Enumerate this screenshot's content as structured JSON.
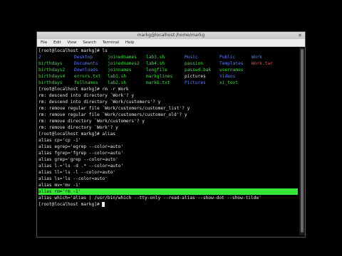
{
  "window": {
    "title": "markg@localhost:/home/markg",
    "close_glyph": "✕"
  },
  "menu": [
    "File",
    "Edit",
    "View",
    "Search",
    "Terminal",
    "Help"
  ],
  "colors": {
    "directory": "#5b7cff",
    "executable": "#3fdf3f",
    "archive": "#e34b4b",
    "image": "#d94bd9",
    "highlight_bg": "#36e636"
  },
  "ls_prompt": "[root@localhost markg]# ls",
  "ls_rows": [
    [
      {
        "t": "2",
        "c": "c-blue"
      },
      {
        "t": "Desktop",
        "c": "c-blue"
      },
      {
        "t": "joinednames",
        "c": "c-green"
      },
      {
        "t": "lab3.sh",
        "c": "c-green"
      },
      {
        "t": "Music",
        "c": "c-blue"
      },
      {
        "t": "Public",
        "c": "c-blue"
      },
      {
        "t": "Work",
        "c": "c-blue"
      }
    ],
    [
      {
        "t": "birthdays",
        "c": "c-green"
      },
      {
        "t": "Documents",
        "c": "c-blue"
      },
      {
        "t": "joinednames2",
        "c": "c-green"
      },
      {
        "t": "lab4.sh",
        "c": "c-green"
      },
      {
        "t": "passion",
        "c": "c-green"
      },
      {
        "t": "Templates",
        "c": "c-blue"
      },
      {
        "t": "Work.tar",
        "c": "c-red"
      }
    ],
    [
      {
        "t": "birthdays2",
        "c": "c-green"
      },
      {
        "t": "Downloads",
        "c": "c-blue"
      },
      {
        "t": "joinnames",
        "c": "c-green"
      },
      {
        "t": "longfile",
        "c": "c-green"
      },
      {
        "t": "passwd.bak",
        "c": "c-green"
      },
      {
        "t": "usernames",
        "c": "c-green"
      },
      {
        "t": "",
        "c": "c-white"
      }
    ],
    [
      {
        "t": "birthdays4",
        "c": "c-green"
      },
      {
        "t": "errors.txt",
        "c": "c-green"
      },
      {
        "t": "lab1.sh",
        "c": "c-green"
      },
      {
        "t": "markglines",
        "c": "c-green"
      },
      {
        "t": "pictures",
        "c": "c-white"
      },
      {
        "t": "Videos",
        "c": "c-blue"
      },
      {
        "t": "",
        "c": "c-white"
      }
    ],
    [
      {
        "t": "birthdays",
        "c": "c-green"
      },
      {
        "t": "fullnames",
        "c": "c-green"
      },
      {
        "t": "lab2.sh",
        "c": "c-green"
      },
      {
        "t": "markG.txt",
        "c": "c-green"
      },
      {
        "t": "Pictures",
        "c": "c-blue"
      },
      {
        "t": "xi_text",
        "c": "c-green"
      },
      {
        "t": "",
        "c": "c-white"
      }
    ]
  ],
  "lines": [
    "[root@localhost markg]# rm -r Work",
    "rm: descend into directory `Work'? y",
    "rm: descend into directory `Work/customers'? y",
    "rm: remove regular file `Work/customers/customer_list'? y",
    "rm: remove regular file `Work/customers/customer_old'? y",
    "rm: remove directory `Work/customers'? y",
    "rm: remove directory `Work'? y",
    "[root@localhost markg]# alias",
    "alias cp='cp -i'",
    "alias egrep='egrep --color=auto'",
    "alias fgrep='fgrep --color=auto'",
    "alias grep='grep --color=auto'",
    "alias l.='ls -d .* --color=auto'",
    "alias ll='ls -l --color=auto'",
    "alias ls='ls --color=auto'",
    "alias mv='mv -i'",
    "alias rm='rm -i'",
    "alias which='alias | /usr/bin/which --tty-only --read-alias --show-dot --show-tilde'",
    "[root@localhost markg]# "
  ],
  "highlighted_line_index": 16
}
